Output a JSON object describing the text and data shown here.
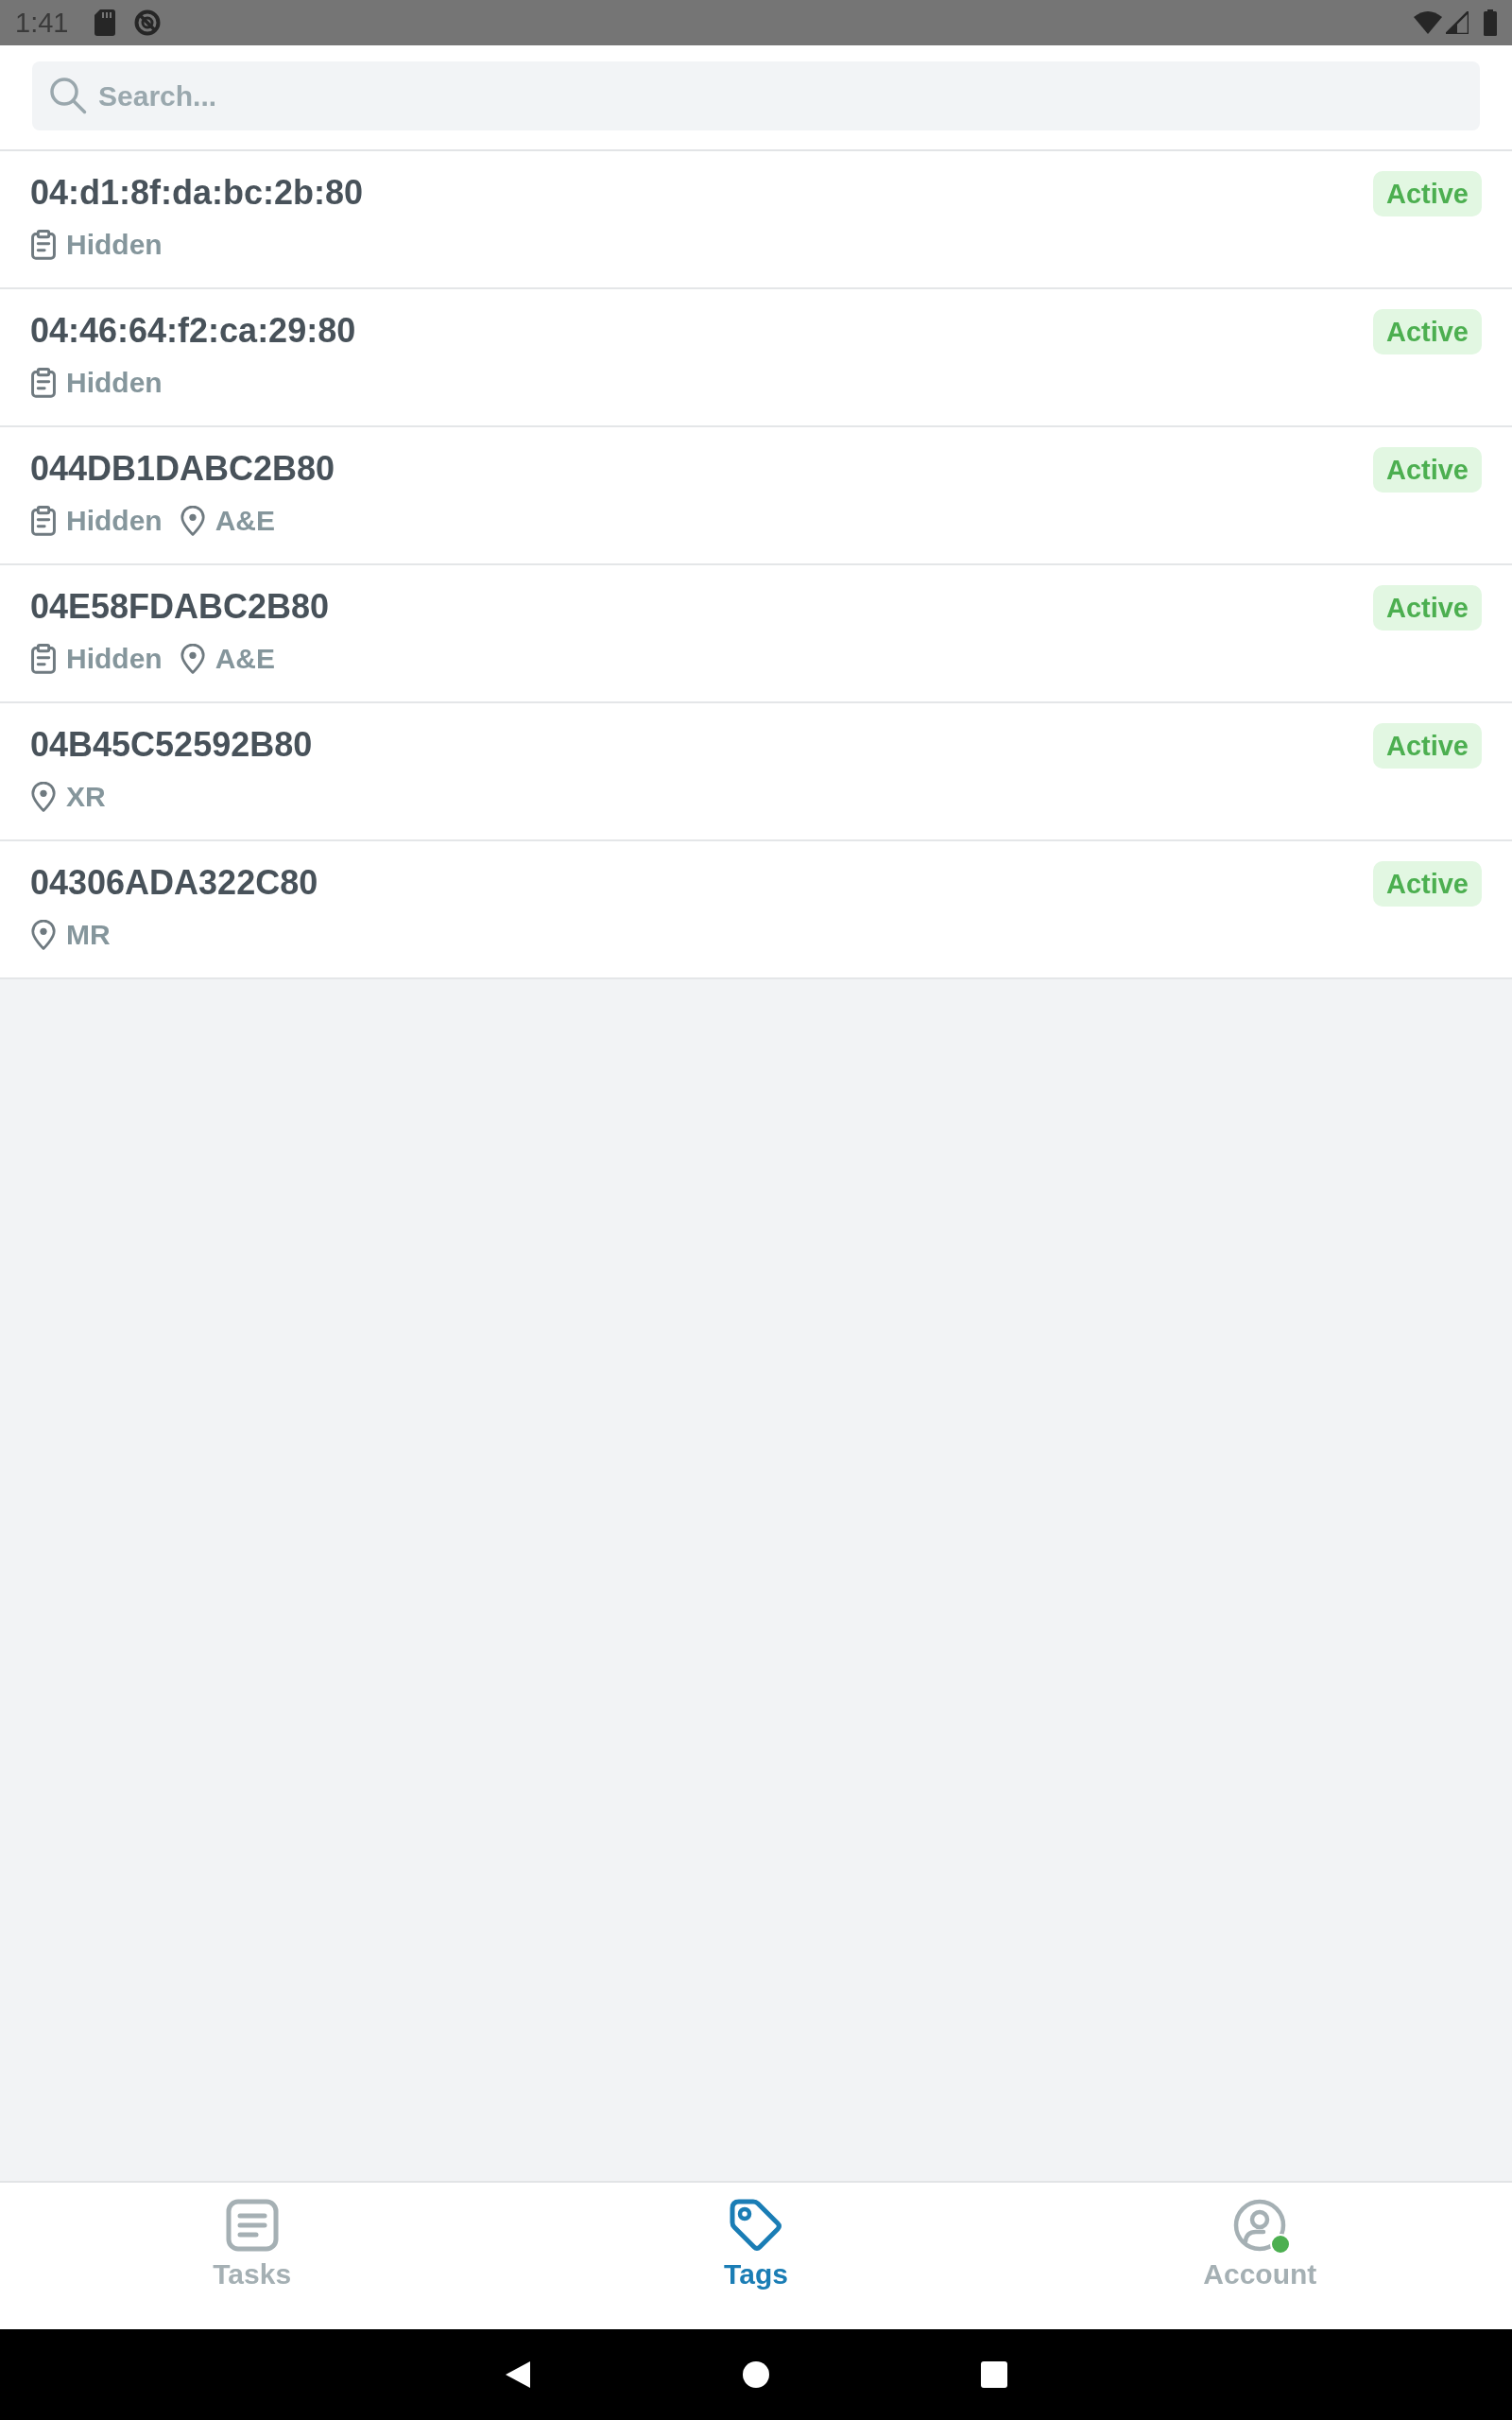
{
  "status_bar": {
    "time": "1:41"
  },
  "search": {
    "placeholder": "Search..."
  },
  "tags": [
    {
      "id": "04:d1:8f:da:bc:2b:80",
      "status": "Active",
      "details": [
        {
          "kind": "visibility",
          "text": "Hidden"
        }
      ]
    },
    {
      "id": "04:46:64:f2:ca:29:80",
      "status": "Active",
      "details": [
        {
          "kind": "visibility",
          "text": "Hidden"
        }
      ]
    },
    {
      "id": "044DB1DABC2B80",
      "status": "Active",
      "details": [
        {
          "kind": "visibility",
          "text": "Hidden"
        },
        {
          "kind": "location",
          "text": "A&E"
        }
      ]
    },
    {
      "id": "04E58FDABC2B80",
      "status": "Active",
      "details": [
        {
          "kind": "visibility",
          "text": "Hidden"
        },
        {
          "kind": "location",
          "text": "A&E"
        }
      ]
    },
    {
      "id": "04B45C52592B80",
      "status": "Active",
      "details": [
        {
          "kind": "location",
          "text": "XR"
        }
      ]
    },
    {
      "id": "04306ADA322C80",
      "status": "Active",
      "details": [
        {
          "kind": "location",
          "text": "MR"
        }
      ]
    }
  ],
  "bottom_nav": [
    {
      "kind": "tasks",
      "label": "Tasks",
      "selected": false,
      "online": false
    },
    {
      "kind": "tags",
      "label": "Tags",
      "selected": true,
      "online": false
    },
    {
      "kind": "account",
      "label": "Account",
      "selected": false,
      "online": true
    }
  ]
}
